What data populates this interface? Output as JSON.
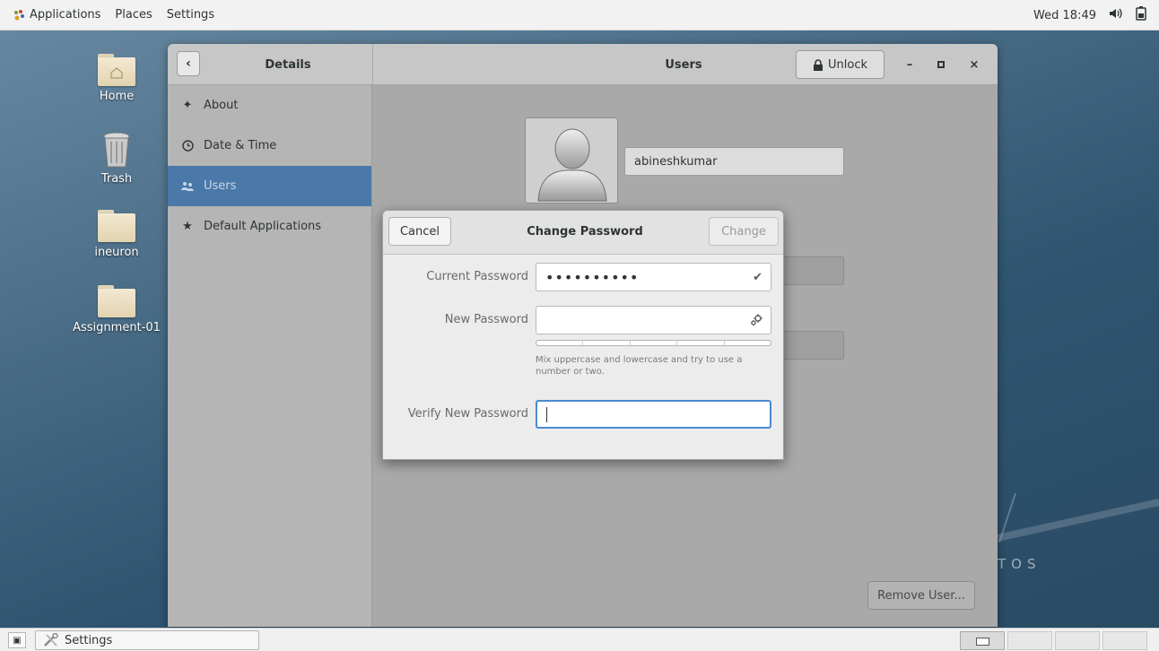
{
  "topbar": {
    "applications": "Applications",
    "places": "Places",
    "settings": "Settings",
    "clock": "Wed 18:49",
    "icons": [
      "gnome-foot-icon",
      "volume-icon",
      "battery-icon"
    ]
  },
  "desktop": {
    "icons": [
      {
        "label": "Home",
        "icon": "home-folder-icon"
      },
      {
        "label": "Trash",
        "icon": "trash-icon"
      },
      {
        "label": "ineuron",
        "icon": "folder-icon"
      },
      {
        "label": "Assignment-01",
        "icon": "folder-icon"
      }
    ],
    "watermark": "TOS"
  },
  "window": {
    "left_title": "Details",
    "main_title": "Users",
    "unlock_label": "Unlock",
    "sidebar": [
      {
        "label": "About",
        "icon": "sparkle-icon"
      },
      {
        "label": "Date & Time",
        "icon": "clock-icon"
      },
      {
        "label": "Users",
        "icon": "users-icon",
        "active": true
      },
      {
        "label": "Default Applications",
        "icon": "star-icon"
      }
    ],
    "user_name": "abineshkumar",
    "remove_user_label": "Remove User..."
  },
  "dialog": {
    "cancel_label": "Cancel",
    "title": "Change Password",
    "change_label": "Change",
    "current_password_label": "Current Password",
    "current_password_value": "••••••••••",
    "new_password_label": "New Password",
    "new_password_value": "",
    "hint": "Mix uppercase and lowercase and try to use a number or two.",
    "verify_label": "Verify New Password",
    "verify_value": "",
    "strength_level": 0
  },
  "taskbar": {
    "task_label": "Settings",
    "workspaces": 4,
    "active_workspace": 1
  },
  "colors": {
    "selection": "#4a78a8",
    "focus_ring": "#4a8ad0"
  }
}
